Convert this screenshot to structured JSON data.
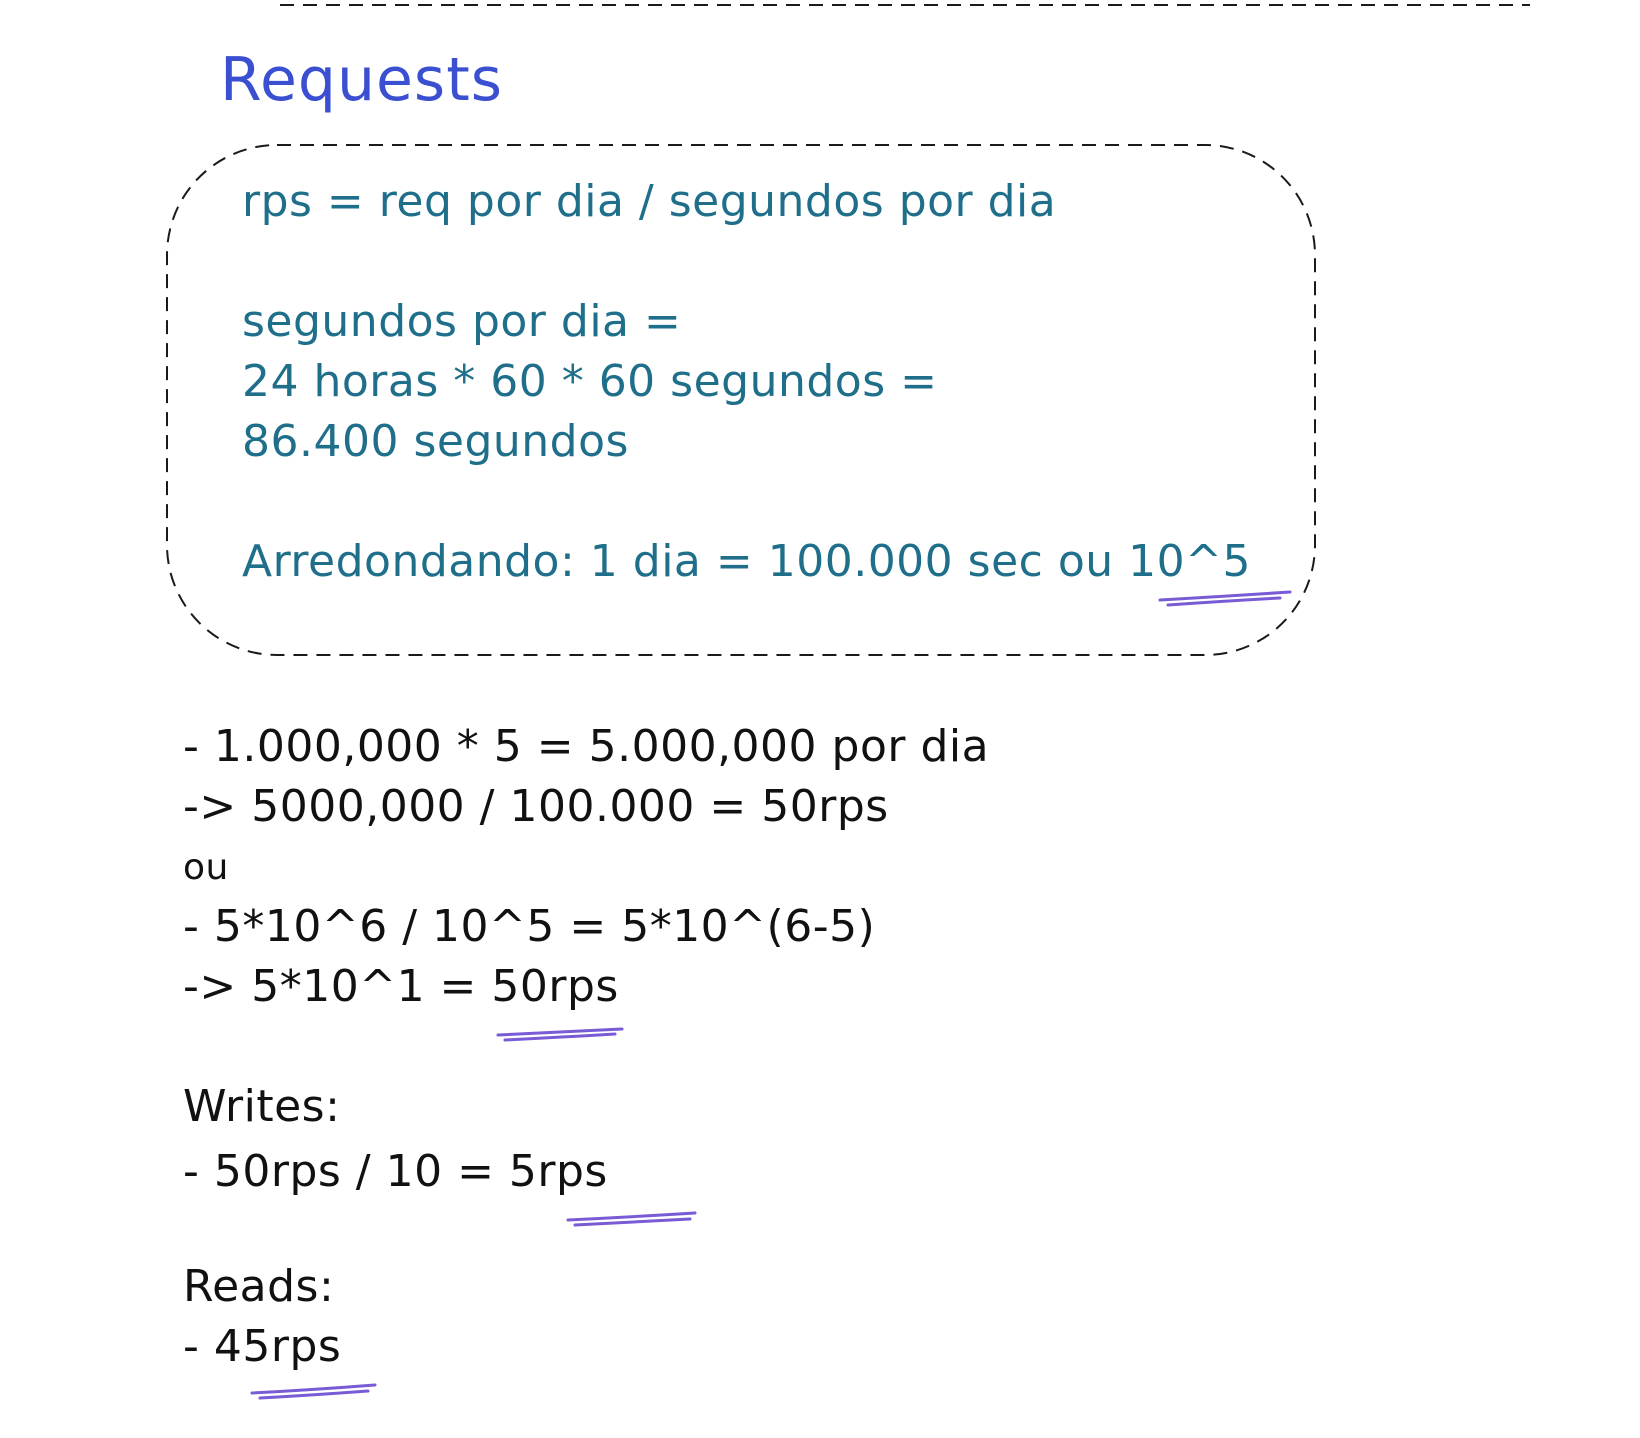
{
  "colors": {
    "title": "#3b4fd1",
    "box_text": "#1f6f8b",
    "body_text": "#111111",
    "underline": "#7a5bd6",
    "stroke": "#1a1a1a"
  },
  "title": "Requests",
  "box": {
    "line1": "rps = req por dia / segundos por dia",
    "line2": "segundos por dia =",
    "line3": "24 horas * 60 * 60 segundos =",
    "line4": "86.400 segundos",
    "line5_prefix": "Arredondando: 1 dia = 100.000 sec ou ",
    "line5_highlight": "10^5"
  },
  "calc": {
    "line1": "- 1.000,000 * 5 = 5.000,000 por dia",
    "line2": "-> 5000,000 / 100.000 = 50rps",
    "line3": "ou",
    "line4": "- 5*10^6 / 10^5 = 5*10^(6-5)",
    "line5_prefix": "-> 5*10^1 = ",
    "line5_highlight": "50rps"
  },
  "writes": {
    "label": "Writes:",
    "line_prefix": "- 50rps / 10 = ",
    "line_highlight": "5rps"
  },
  "reads": {
    "label": "Reads:",
    "line_prefix": "- ",
    "line_highlight": "45rps"
  }
}
